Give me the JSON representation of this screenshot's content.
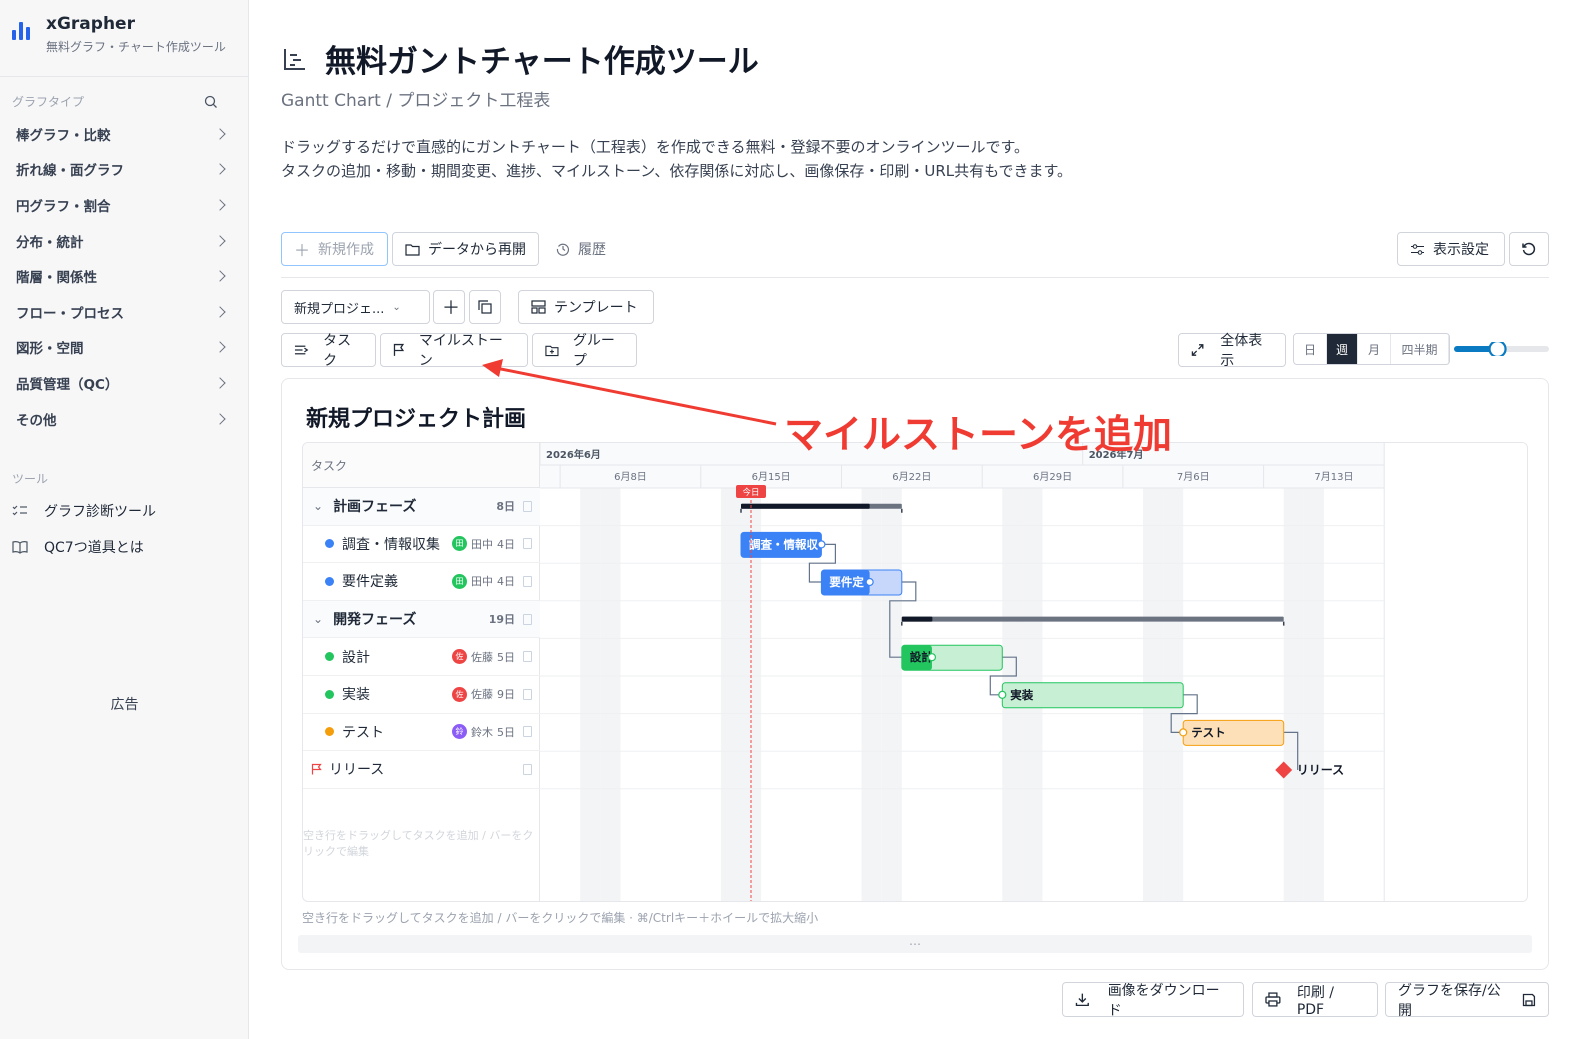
{
  "brand": {
    "title": "xGrapher",
    "subtitle": "無料グラフ・チャート作成ツール"
  },
  "sidebar": {
    "section_graph": "グラフタイプ",
    "items": [
      {
        "label": "棒グラフ・比較"
      },
      {
        "label": "折れ線・面グラフ"
      },
      {
        "label": "円グラフ・割合"
      },
      {
        "label": "分布・統計"
      },
      {
        "label": "階層・関係性"
      },
      {
        "label": "フロー・プロセス"
      },
      {
        "label": "図形・空間"
      },
      {
        "label": "品質管理（QC）"
      },
      {
        "label": "その他"
      }
    ],
    "section_tools": "ツール",
    "tools": [
      {
        "label": "グラフ診断ツール",
        "icon": "checklist-icon"
      },
      {
        "label": "QC7つ道具とは",
        "icon": "book-icon"
      }
    ],
    "ad": "広告"
  },
  "page": {
    "title": "無料ガントチャート作成ツール",
    "subtitle": "Gantt Chart / プロジェクト工程表",
    "desc1": "ドラッグするだけで直感的にガントチャート（工程表）を作成できる無料・登録不要のオンラインツールです。",
    "desc2": "タスクの追加・移動・期間変更、進捗、マイルストーン、依存関係に対応し、画像保存・印刷・URL共有もできます。"
  },
  "toolbar": {
    "new": "新規作成",
    "resume": "データから再開",
    "history": "履歴",
    "display": "表示設定",
    "project_select": "新規プロジェ...",
    "template": "テンプレート",
    "task": "タスク",
    "milestone": "マイルストーン",
    "group": "グループ",
    "fit": "全体表示",
    "scale": [
      "日",
      "週",
      "月",
      "四半期"
    ],
    "scale_selected": "週",
    "zoom_level": 0.45
  },
  "annotation": "マイルストーンを追加",
  "chart": {
    "title": "新規プロジェクト計画",
    "task_header": "タスク",
    "months": [
      {
        "label": "2026年6月"
      },
      {
        "label": "2026年7月"
      }
    ],
    "weeks": [
      "6月8日",
      "6月15日",
      "6月22日",
      "6月29日",
      "7月6日",
      "7月13日"
    ],
    "today_label": "今日",
    "start_date": "2026-06-04",
    "today": "2026-06-14",
    "rows": [
      {
        "type": "group",
        "name": "計画フェーズ",
        "duration": "8日",
        "start": "2026-06-14",
        "days": 8,
        "progress": 0.8
      },
      {
        "type": "task",
        "name": "調査・情報収集",
        "bar_label": "調査・情報収",
        "color": "#3b82f6",
        "light": "#bfdbfe",
        "owner": "田中",
        "owner_initial": "田",
        "owner_color": "#22c55e",
        "duration": "4日",
        "start": "2026-06-14",
        "days": 4,
        "progress": 1.0
      },
      {
        "type": "task",
        "name": "要件定義",
        "bar_label": "要件定",
        "color": "#3b82f6",
        "light": "#c7d7fb",
        "owner": "田中",
        "owner_initial": "田",
        "owner_color": "#22c55e",
        "duration": "4日",
        "start": "2026-06-18",
        "days": 4,
        "progress": 0.6
      },
      {
        "type": "group",
        "name": "開発フェーズ",
        "duration": "19日",
        "start": "2026-06-22",
        "days": 19,
        "progress": 0.08
      },
      {
        "type": "task",
        "name": "設計",
        "bar_label": "設計",
        "color": "#22c55e",
        "light": "#c6efd3",
        "owner": "佐藤",
        "owner_initial": "佐",
        "owner_color": "#ef4444",
        "duration": "5日",
        "start": "2026-06-22",
        "days": 5,
        "progress": 0.3
      },
      {
        "type": "task",
        "name": "実装",
        "bar_label": "実装",
        "color": "#22c55e",
        "light": "#c6efd3",
        "owner": "佐藤",
        "owner_initial": "佐",
        "owner_color": "#ef4444",
        "duration": "9日",
        "start": "2026-06-27",
        "days": 9,
        "progress": 0.0
      },
      {
        "type": "task",
        "name": "テスト",
        "bar_label": "テスト",
        "color": "#f59e0b",
        "light": "#fde0b8",
        "owner": "鈴木",
        "owner_initial": "鈴",
        "owner_color": "#8b5cf6",
        "duration": "5日",
        "start": "2026-07-06",
        "days": 5,
        "progress": 0.0
      },
      {
        "type": "milestone",
        "name": "リリース",
        "bar_label": "リリース",
        "start": "2026-07-11"
      }
    ],
    "empty_hint": "空き行をドラッグしてタスクを追加 / バーをクリックで編集",
    "footer_hint": "空き行をドラッグしてタスクを追加 / バーをクリックで編集 · ⌘/Ctrlキー＋ホイールで拡大縮小"
  },
  "actions": {
    "download": "画像をダウンロード",
    "print": "印刷 / PDF",
    "save": "グラフを保存/公開"
  },
  "colors": {
    "accent": "#2563eb",
    "annotation": "#ef3b32",
    "today": "#ef4444"
  }
}
